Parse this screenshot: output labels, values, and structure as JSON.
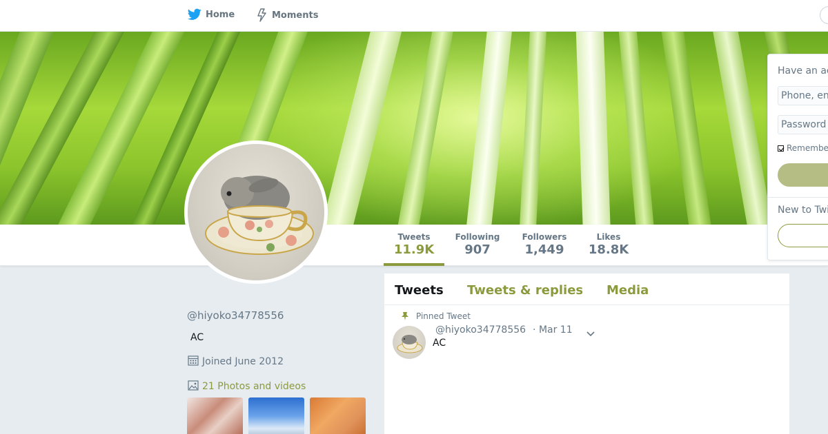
{
  "nav": {
    "home_label": "Home",
    "moments_label": "Moments"
  },
  "profile": {
    "handle": "@hiyoko34778556",
    "bio": "AC",
    "joined": "Joined June 2012",
    "photos_label": "21 Photos and videos"
  },
  "stats": [
    {
      "label": "Tweets",
      "value": "11.9K"
    },
    {
      "label": "Following",
      "value": "907"
    },
    {
      "label": "Followers",
      "value": "1,449"
    },
    {
      "label": "Likes",
      "value": "18.8K"
    }
  ],
  "timeline": {
    "tabs": [
      "Tweets",
      "Tweets & replies",
      "Media"
    ],
    "pinned_label": "Pinned Tweet",
    "tweet": {
      "handle": "@hiyoko34778556",
      "date": "· Mar 11",
      "text": "AC"
    }
  },
  "login": {
    "title": "Have an ac",
    "phone_placeholder": "Phone, en",
    "password_placeholder": "Password",
    "remember_label": "Remembe",
    "new_label": "New to Twi"
  },
  "colors": {
    "accent": "#8c9a3e",
    "twitter_blue": "#1da1f2"
  },
  "icons": [
    "twitter-bird-icon",
    "lightning-icon",
    "calendar-icon",
    "image-icon",
    "pin-icon",
    "chevron-down-icon"
  ]
}
